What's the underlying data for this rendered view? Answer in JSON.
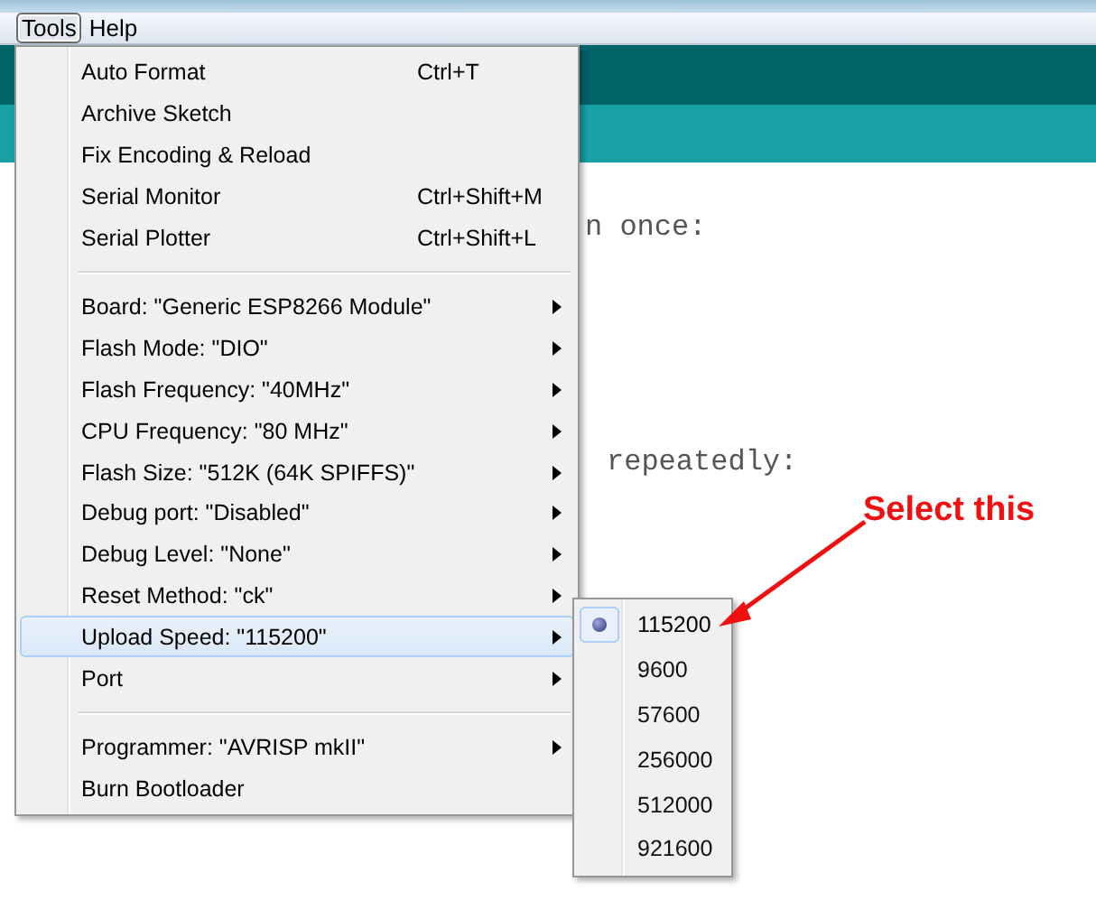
{
  "menubar": [
    {
      "label": "Tools",
      "selected": true
    },
    {
      "label": "Help",
      "selected": false
    }
  ],
  "editor": {
    "lines": [
      "n once:",
      "repeatedly:"
    ]
  },
  "tools_menu": [
    {
      "kind": "command",
      "label": "Auto Format",
      "shortcut": "Ctrl+T",
      "selected": false
    },
    {
      "kind": "command",
      "label": "Archive Sketch",
      "selected": false
    },
    {
      "kind": "command",
      "label": "Fix Encoding & Reload",
      "selected": false
    },
    {
      "kind": "command",
      "label": "Serial Monitor",
      "shortcut": "Ctrl+Shift+M",
      "selected": false
    },
    {
      "kind": "command",
      "label": "Serial Plotter",
      "shortcut": "Ctrl+Shift+L",
      "selected": false
    },
    {
      "kind": "separator"
    },
    {
      "kind": "submenu",
      "label": "Board: \"Generic ESP8266 Module\"",
      "selected": false
    },
    {
      "kind": "submenu",
      "label": "Flash Mode: \"DIO\"",
      "selected": false
    },
    {
      "kind": "submenu",
      "label": "Flash Frequency: \"40MHz\"",
      "selected": false
    },
    {
      "kind": "submenu",
      "label": "CPU Frequency: \"80 MHz\"",
      "selected": false
    },
    {
      "kind": "submenu",
      "label": "Flash Size: \"512K (64K SPIFFS)\"",
      "selected": false
    },
    {
      "kind": "submenu",
      "label": "Debug port: \"Disabled\"",
      "selected": false
    },
    {
      "kind": "submenu",
      "label": "Debug Level: \"None\"",
      "selected": false
    },
    {
      "kind": "submenu",
      "label": "Reset Method: \"ck\"",
      "selected": false
    },
    {
      "kind": "submenu",
      "label": "Upload Speed: \"115200\"",
      "selected": true
    },
    {
      "kind": "submenu",
      "label": "Port",
      "selected": false
    },
    {
      "kind": "separator"
    },
    {
      "kind": "submenu",
      "label": "Programmer: \"AVRISP mkII\"",
      "selected": false
    },
    {
      "kind": "command",
      "label": "Burn Bootloader",
      "selected": false
    }
  ],
  "upload_speed_menu": [
    {
      "label": "115200",
      "selected": true
    },
    {
      "label": "9600",
      "selected": false
    },
    {
      "label": "57600",
      "selected": false
    },
    {
      "label": "256000",
      "selected": false
    },
    {
      "label": "512000",
      "selected": false
    },
    {
      "label": "921600",
      "selected": false
    }
  ],
  "annotation": {
    "text": "Select this"
  }
}
